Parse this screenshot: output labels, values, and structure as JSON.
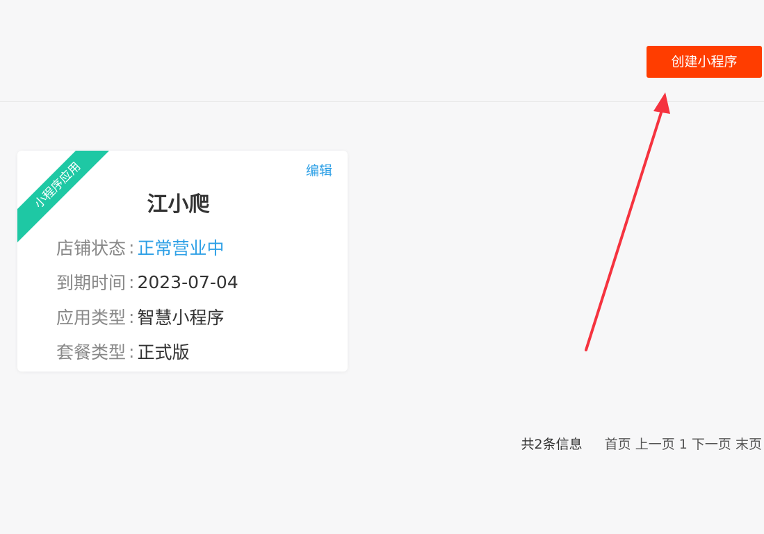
{
  "header": {
    "create_button_label": "创建小程序"
  },
  "card": {
    "ribbon_label": "小程序应用",
    "edit_label": "编辑",
    "title": "江小爬",
    "fields": [
      {
        "label": "店铺状态",
        "sep": ":",
        "value": "正常营业中"
      },
      {
        "label": "到期时间",
        "sep": ":",
        "value": "2023-07-04"
      },
      {
        "label": "应用类型",
        "sep": ":",
        "value": "智慧小程序"
      },
      {
        "label": "套餐类型",
        "sep": ":",
        "value": "正式版"
      }
    ]
  },
  "pagination": {
    "total_text": "共2条信息",
    "first": "首页",
    "prev": "上一页",
    "current": "1",
    "next": "下一页",
    "last": "末页"
  },
  "colors": {
    "accent_button": "#ff3d00",
    "ribbon": "#1ec8a4",
    "link": "#2ea0e6",
    "arrow": "#f5333f"
  }
}
